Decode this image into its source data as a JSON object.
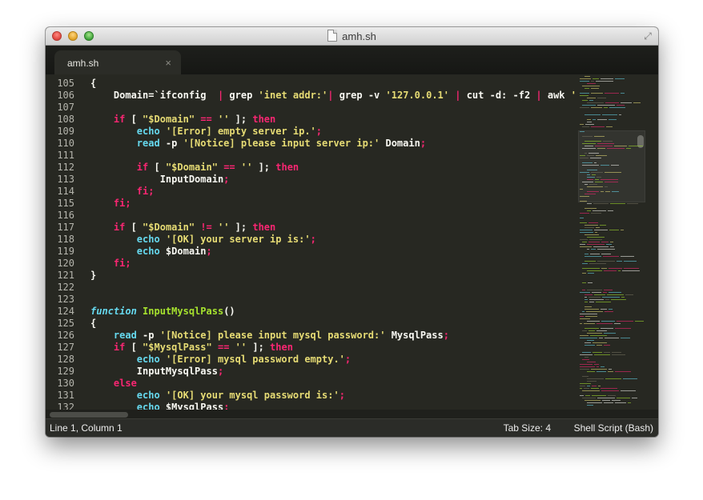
{
  "window": {
    "title": "amh.sh"
  },
  "tab": {
    "label": "amh.sh",
    "close_glyph": "×"
  },
  "editor": {
    "line_numbers": [
      "105",
      "106",
      "107",
      "108",
      "109",
      "110",
      "111",
      "112",
      "113",
      "114",
      "115",
      "116",
      "117",
      "118",
      "119",
      "120",
      "121",
      "122",
      "123",
      "124",
      "125",
      "126",
      "127",
      "128",
      "129",
      "130",
      "131",
      "132"
    ],
    "lines": [
      [
        [
          "t",
          "{"
        ]
      ],
      [
        [
          "t",
          "    Domain=`ifconfig  "
        ],
        [
          "o",
          "|"
        ],
        [
          "t",
          " grep "
        ],
        [
          "s",
          "'inet addr:'"
        ],
        [
          "o",
          "|"
        ],
        [
          "t",
          " grep -v "
        ],
        [
          "s",
          "'127.0.0.1'"
        ],
        [
          "t",
          " "
        ],
        [
          "o",
          "|"
        ],
        [
          "t",
          " cut -d: -f2 "
        ],
        [
          "o",
          "|"
        ],
        [
          "t",
          " awk "
        ],
        [
          "s",
          "'{ p"
        ]
      ],
      [],
      [
        [
          "t",
          "    "
        ],
        [
          "k",
          "if"
        ],
        [
          "t",
          " [ "
        ],
        [
          "s",
          "\"$Domain\""
        ],
        [
          "t",
          " "
        ],
        [
          "o",
          "=="
        ],
        [
          "t",
          " "
        ],
        [
          "s",
          "''"
        ],
        [
          "t",
          " ]; "
        ],
        [
          "k",
          "then"
        ]
      ],
      [
        [
          "t",
          "        "
        ],
        [
          "b",
          "echo"
        ],
        [
          "t",
          " "
        ],
        [
          "s",
          "'[Error] empty server ip.'"
        ],
        [
          "o",
          ";"
        ]
      ],
      [
        [
          "t",
          "        "
        ],
        [
          "b",
          "read"
        ],
        [
          "t",
          " -p "
        ],
        [
          "s",
          "'[Notice] please input server ip:'"
        ],
        [
          "t",
          " Domain"
        ],
        [
          "o",
          ";"
        ]
      ],
      [],
      [
        [
          "t",
          "        "
        ],
        [
          "k",
          "if"
        ],
        [
          "t",
          " [ "
        ],
        [
          "s",
          "\"$Domain\""
        ],
        [
          "t",
          " "
        ],
        [
          "o",
          "=="
        ],
        [
          "t",
          " "
        ],
        [
          "s",
          "''"
        ],
        [
          "t",
          " ]; "
        ],
        [
          "k",
          "then"
        ]
      ],
      [
        [
          "t",
          "            InputDomain"
        ],
        [
          "o",
          ";"
        ]
      ],
      [
        [
          "t",
          "        "
        ],
        [
          "k",
          "fi"
        ],
        [
          "o",
          ";"
        ]
      ],
      [
        [
          "t",
          "    "
        ],
        [
          "k",
          "fi"
        ],
        [
          "o",
          ";"
        ]
      ],
      [],
      [
        [
          "t",
          "    "
        ],
        [
          "k",
          "if"
        ],
        [
          "t",
          " [ "
        ],
        [
          "s",
          "\"$Domain\""
        ],
        [
          "t",
          " "
        ],
        [
          "o",
          "!="
        ],
        [
          "t",
          " "
        ],
        [
          "s",
          "''"
        ],
        [
          "t",
          " ]; "
        ],
        [
          "k",
          "then"
        ]
      ],
      [
        [
          "t",
          "        "
        ],
        [
          "b",
          "echo"
        ],
        [
          "t",
          " "
        ],
        [
          "s",
          "'[OK] your server ip is:'"
        ],
        [
          "o",
          ";"
        ]
      ],
      [
        [
          "t",
          "        "
        ],
        [
          "b",
          "echo"
        ],
        [
          "t",
          " $Domain"
        ],
        [
          "o",
          ";"
        ]
      ],
      [
        [
          "t",
          "    "
        ],
        [
          "k",
          "fi"
        ],
        [
          "o",
          ";"
        ]
      ],
      [
        [
          "t",
          "}"
        ]
      ],
      [],
      [],
      [
        [
          "f",
          "function"
        ],
        [
          "t",
          " "
        ],
        [
          "n",
          "InputMysqlPass"
        ],
        [
          "t",
          "()"
        ]
      ],
      [
        [
          "t",
          "{"
        ]
      ],
      [
        [
          "t",
          "    "
        ],
        [
          "b",
          "read"
        ],
        [
          "t",
          " -p "
        ],
        [
          "s",
          "'[Notice] please input mysql password:'"
        ],
        [
          "t",
          " MysqlPass"
        ],
        [
          "o",
          ";"
        ]
      ],
      [
        [
          "t",
          "    "
        ],
        [
          "k",
          "if"
        ],
        [
          "t",
          " [ "
        ],
        [
          "s",
          "\"$MysqlPass\""
        ],
        [
          "t",
          " "
        ],
        [
          "o",
          "=="
        ],
        [
          "t",
          " "
        ],
        [
          "s",
          "''"
        ],
        [
          "t",
          " ]; "
        ],
        [
          "k",
          "then"
        ]
      ],
      [
        [
          "t",
          "        "
        ],
        [
          "b",
          "echo"
        ],
        [
          "t",
          " "
        ],
        [
          "s",
          "'[Error] mysql password empty.'"
        ],
        [
          "o",
          ";"
        ]
      ],
      [
        [
          "t",
          "        InputMysqlPass"
        ],
        [
          "o",
          ";"
        ]
      ],
      [
        [
          "t",
          "    "
        ],
        [
          "k",
          "else"
        ]
      ],
      [
        [
          "t",
          "        "
        ],
        [
          "b",
          "echo"
        ],
        [
          "t",
          " "
        ],
        [
          "s",
          "'[OK] your mysql password is:'"
        ],
        [
          "o",
          ";"
        ]
      ],
      [
        [
          "t",
          "        "
        ],
        [
          "b",
          "echo"
        ],
        [
          "t",
          " $MysqlPass"
        ],
        [
          "o",
          ";"
        ]
      ]
    ]
  },
  "statusbar": {
    "position": "Line 1, Column 1",
    "tab_size": "Tab Size: 4",
    "syntax": "Shell Script (Bash)"
  },
  "colors": {
    "background": "#272822",
    "keyword": "#f92672",
    "builtin": "#66d9ef",
    "string": "#e6db74",
    "function_name": "#a6e22e",
    "text": "#f8f8f2"
  },
  "icons": [
    "document-icon",
    "fullscreen-icon",
    "close-icon"
  ]
}
